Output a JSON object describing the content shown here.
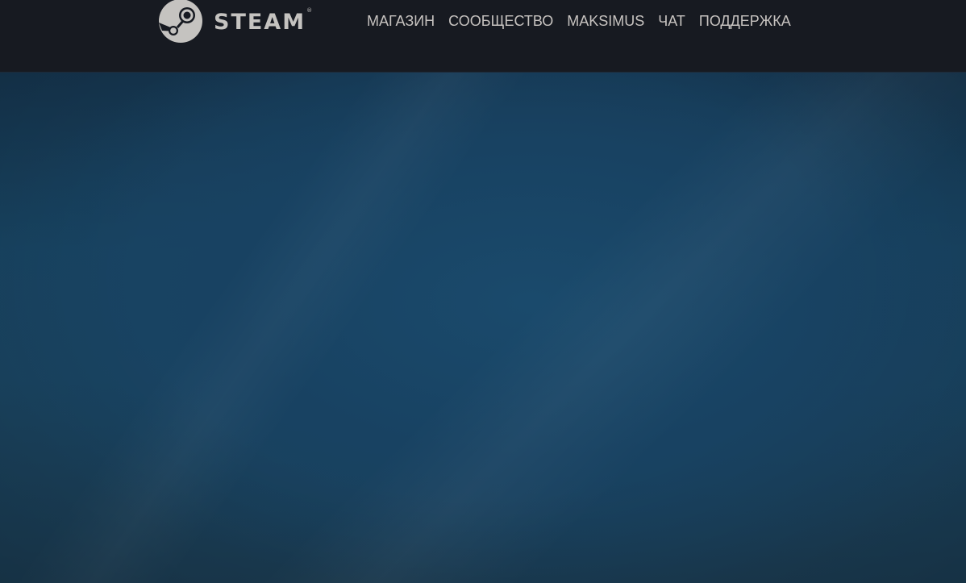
{
  "header": {
    "logo": {
      "icon": "steam-logo-icon",
      "wordmark": "STEAM",
      "registered_mark": "®"
    },
    "nav": [
      {
        "id": "store",
        "label": "МАГАЗИН"
      },
      {
        "id": "community",
        "label": "СООБЩЕСТВО"
      },
      {
        "id": "profile",
        "label": "MAKSIMUS"
      },
      {
        "id": "chat",
        "label": "ЧАТ"
      },
      {
        "id": "support",
        "label": "ПОДДЕРЖКА"
      }
    ]
  },
  "colors": {
    "header_bg": "#171a21",
    "nav_text": "#c7c3c0",
    "hero_bg": "#184563"
  }
}
